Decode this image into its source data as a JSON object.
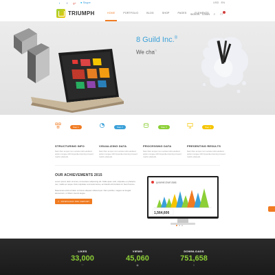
{
  "topbar": {
    "social": [
      "t",
      "f",
      "g+"
    ],
    "skype": "Skype",
    "langs": [
      "USD",
      "EN"
    ]
  },
  "header": {
    "logo": "TRIUMPH",
    "nav": [
      "HOME",
      "PORTFOLIO",
      "BLOG",
      "SHOP",
      "PAGES",
      "ELEMENTS"
    ],
    "sign_in": "SIGN IN",
    "login": "LOGIN",
    "cart_count": "0"
  },
  "hero": {
    "title": "8 Guild Inc.",
    "title_sup": "®",
    "subtitle": "We cha",
    "subtitle_fade": "n"
  },
  "features": [
    {
      "tag": "Step 1",
      "tag_color": "#f07b21",
      "title": "STRUCTURING INFO",
      "desc": "Nam liber tempor cum soluta nobis eleifend option congue nihil imperdiet doming id quod mazim placerat."
    },
    {
      "tag": "Step 2",
      "tag_color": "#3aa0d8",
      "title": "VISUALIZING DATA",
      "desc": "Nam liber tempor cum soluta nobis eleifend option congue nihil imperdiet doming id quod mazim placerat."
    },
    {
      "tag": "Step 3",
      "tag_color": "#8ccf36",
      "title": "PROCESSING DATA",
      "desc": "Nam liber tempor cum soluta nobis eleifend option congue nihil imperdiet doming id quod mazim placerat."
    },
    {
      "tag": "Step 4",
      "tag_color": "#f5c400",
      "title": "PRESENTING RESULTS",
      "desc": "Nam liber tempor cum soluta nobis eleifend option congue nihil imperdiet doming id quod mazim placerat."
    }
  ],
  "achievements": {
    "title": "OUR ACHIEVEMENTS 2015",
    "p1": "Lorem ipsum dolor sit amet, consectetur adipiscing elit. Nulla quam velit, vulputate eu pharetra nec, mattis ac neque. Duis vulputate commodo lectus, ac blandit elit tincidunt id. Sed rhoncus.",
    "p2": "Maecenas euismod diam vel lorem aliquam ullamcorper. Nam porttitor, magna vel feugiat elementum, mi libero viverra augue.",
    "button": "DOWNLOAD PDF REPORT"
  },
  "monitor": {
    "chart_title": "pyramid chart stats",
    "number": "1,564,606"
  },
  "stats": [
    {
      "label": "LIKES",
      "value": "33,000",
      "icon": "♡"
    },
    {
      "label": "VIEWS",
      "value": "45,060",
      "icon": "◉"
    },
    {
      "label": "DOWNLOADS",
      "value": "751,658",
      "icon": "⇩"
    }
  ],
  "colors": {
    "accent": "#f07b21",
    "blue": "#3aa0d8",
    "green": "#8ccf36"
  }
}
